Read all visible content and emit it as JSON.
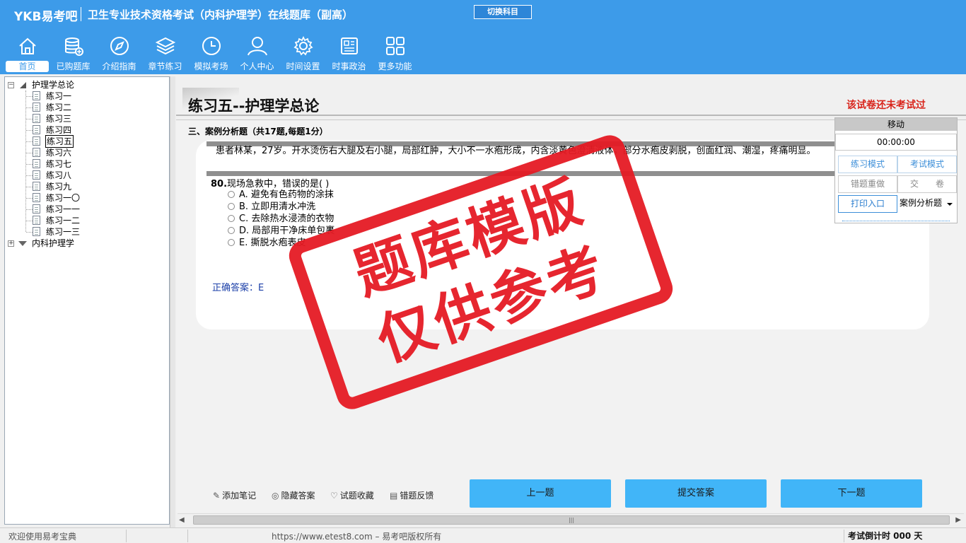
{
  "header": {
    "brand": "YKB易考吧",
    "title": "卫生专业技术资格考试（内科护理学）在线题库（副高）",
    "switch_subject": "切换科目"
  },
  "nav": [
    {
      "label": "首页",
      "icon": "home-icon"
    },
    {
      "label": "已购题库",
      "icon": "database-icon"
    },
    {
      "label": "介绍指南",
      "icon": "compass-icon"
    },
    {
      "label": "章节练习",
      "icon": "layers-icon"
    },
    {
      "label": "模拟考场",
      "icon": "clock-icon"
    },
    {
      "label": "个人中心",
      "icon": "user-icon"
    },
    {
      "label": "时间设置",
      "icon": "gear-icon"
    },
    {
      "label": "时事政治",
      "icon": "news-icon"
    },
    {
      "label": "更多功能",
      "icon": "grid-icon"
    }
  ],
  "tree": {
    "root1": "护理学总论",
    "children": [
      "练习一",
      "练习二",
      "练习三",
      "练习四",
      "练习五",
      "练习六",
      "练习七",
      "练习八",
      "练习九",
      "练习一〇",
      "练习一一",
      "练习一二",
      "练习一三"
    ],
    "selected_index": 4,
    "root2": "内科护理学"
  },
  "paper": {
    "title": "练习五--护理学总论",
    "status": "该试卷还未考试过",
    "section": "三、案例分析题（共17题,每题1分）",
    "case_text": "患者林某，27岁。开水烫伤右大腿及右小腿，局部红肿，大小不一水疱形成，内含淡黄色澄清液体，部分水疱皮剥脱，创面红润、潮湿，疼痛明显。",
    "question_no": "80.",
    "question": "现场急救中，错误的是( )",
    "options": [
      "A. 避免有色药物的涂抹",
      "B. 立即用清水冲洗",
      "C. 去除热水浸渍的衣物",
      "D. 局部用干净床单包裹",
      "E. 撕脱水疱表皮"
    ],
    "answer": "正确答案：E"
  },
  "control": {
    "move": "移动",
    "timer": "00:00:00",
    "practice_mode": "练习模式",
    "exam_mode": "考试模式",
    "redo_wrong": "错题重做",
    "submit_paper": "交　　卷",
    "print": "打印入口",
    "question_type": "案例分析题"
  },
  "tools": {
    "add_note": "添加笔记",
    "hide_answer": "隐藏答案",
    "favorite": "试题收藏",
    "feedback": "错题反馈"
  },
  "buttons": {
    "prev": "上一题",
    "submit": "提交答案",
    "next": "下一题"
  },
  "statusbar": {
    "welcome": "欢迎使用易考宝典",
    "url": "https://www.etest8.com – 易考吧版权所有",
    "countdown": "考试倒计时 000 天"
  },
  "watermark": {
    "line1": "题库模版",
    "line2": "仅供参考"
  }
}
